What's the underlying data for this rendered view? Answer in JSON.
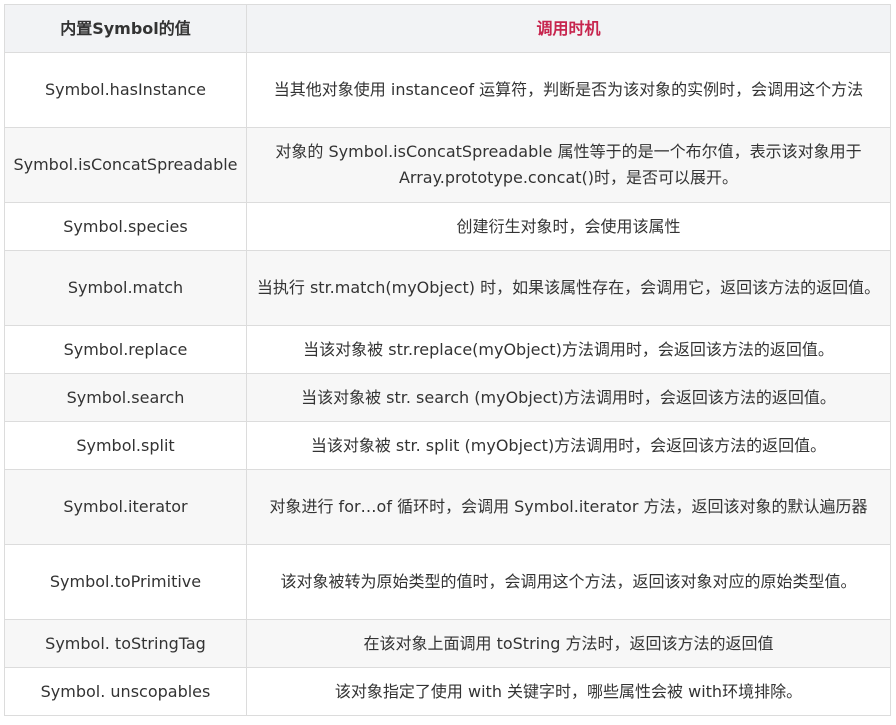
{
  "table": {
    "headers": {
      "name": "内置Symbol的值",
      "when": "调用时机"
    },
    "rows": [
      {
        "name": "Symbol.hasInstance",
        "desc": "当其他对象使用 instanceof 运算符，判断是否为该对象的实例时，会调用这个方法"
      },
      {
        "name": "Symbol.isConcatSpreadable",
        "desc": "对象的 Symbol.isConcatSpreadable 属性等于的是一个布尔值，表示该对象用于 Array.prototype.concat()时，是否可以展开。"
      },
      {
        "name": "Symbol.species",
        "desc": "创建衍生对象时，会使用该属性"
      },
      {
        "name": "Symbol.match",
        "desc": "当执行 str.match(myObject) 时，如果该属性存在，会调用它，返回该方法的返回值。"
      },
      {
        "name": "Symbol.replace",
        "desc": "当该对象被 str.replace(myObject)方法调用时，会返回该方法的返回值。"
      },
      {
        "name": "Symbol.search",
        "desc": "当该对象被 str. search (myObject)方法调用时，会返回该方法的返回值。"
      },
      {
        "name": "Symbol.split",
        "desc": "当该对象被 str. split (myObject)方法调用时，会返回该方法的返回值。"
      },
      {
        "name": "Symbol.iterator",
        "desc": "对象进行 for…of 循环时，会调用 Symbol.iterator 方法，返回该对象的默认遍历器"
      },
      {
        "name": "Symbol.toPrimitive",
        "desc": "该对象被转为原始类型的值时，会调用这个方法，返回该对象对应的原始类型值。"
      },
      {
        "name": "Symbol. toStringTag",
        "desc": "在该对象上面调用 toString 方法时，返回该方法的返回值"
      },
      {
        "name": "Symbol. unscopables",
        "desc": "该对象指定了使用 with 关键字时，哪些属性会被 with环境排除。"
      }
    ]
  }
}
